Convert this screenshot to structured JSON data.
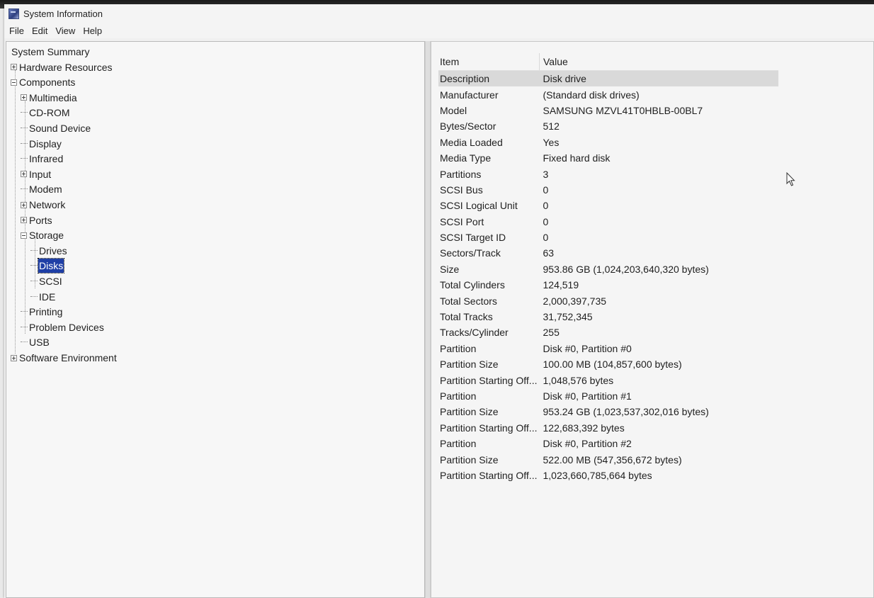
{
  "window": {
    "title": "System Information"
  },
  "menu": [
    "File",
    "Edit",
    "View",
    "Help"
  ],
  "tree": [
    {
      "label": "System Summary",
      "level": 0,
      "expander": "none",
      "line": false
    },
    {
      "label": "Hardware Resources",
      "level": 0,
      "expander": "plus",
      "line": false
    },
    {
      "label": "Components",
      "level": 0,
      "expander": "minus",
      "line": false
    },
    {
      "label": "Multimedia",
      "level": 1,
      "expander": "plus",
      "line": false
    },
    {
      "label": "CD-ROM",
      "level": 1,
      "expander": "none",
      "line": true
    },
    {
      "label": "Sound Device",
      "level": 1,
      "expander": "none",
      "line": true
    },
    {
      "label": "Display",
      "level": 1,
      "expander": "none",
      "line": true
    },
    {
      "label": "Infrared",
      "level": 1,
      "expander": "none",
      "line": true
    },
    {
      "label": "Input",
      "level": 1,
      "expander": "plus",
      "line": false
    },
    {
      "label": "Modem",
      "level": 1,
      "expander": "none",
      "line": true
    },
    {
      "label": "Network",
      "level": 1,
      "expander": "plus",
      "line": false
    },
    {
      "label": "Ports",
      "level": 1,
      "expander": "plus",
      "line": false
    },
    {
      "label": "Storage",
      "level": 1,
      "expander": "minus",
      "line": false
    },
    {
      "label": "Drives",
      "level": 2,
      "expander": "none",
      "line": true
    },
    {
      "label": "Disks",
      "level": 2,
      "expander": "none",
      "line": true,
      "selected": true
    },
    {
      "label": "SCSI",
      "level": 2,
      "expander": "none",
      "line": true
    },
    {
      "label": "IDE",
      "level": 2,
      "expander": "none",
      "line": true
    },
    {
      "label": "Printing",
      "level": 1,
      "expander": "none",
      "line": true
    },
    {
      "label": "Problem Devices",
      "level": 1,
      "expander": "none",
      "line": true
    },
    {
      "label": "USB",
      "level": 1,
      "expander": "none",
      "line": true
    },
    {
      "label": "Software Environment",
      "level": 0,
      "expander": "plus",
      "line": false
    }
  ],
  "details": {
    "headers": {
      "item": "Item",
      "value": "Value"
    },
    "rows": [
      {
        "item": "Description",
        "value": "Disk drive",
        "selected": true
      },
      {
        "item": "Manufacturer",
        "value": "(Standard disk drives)"
      },
      {
        "item": "Model",
        "value": "SAMSUNG MZVL41T0HBLB-00BL7"
      },
      {
        "item": "Bytes/Sector",
        "value": "512"
      },
      {
        "item": "Media Loaded",
        "value": "Yes"
      },
      {
        "item": "Media Type",
        "value": "Fixed hard disk"
      },
      {
        "item": "Partitions",
        "value": "3"
      },
      {
        "item": "SCSI Bus",
        "value": "0"
      },
      {
        "item": "SCSI Logical Unit",
        "value": "0"
      },
      {
        "item": "SCSI Port",
        "value": "0"
      },
      {
        "item": "SCSI Target ID",
        "value": "0"
      },
      {
        "item": "Sectors/Track",
        "value": "63"
      },
      {
        "item": "Size",
        "value": "953.86 GB (1,024,203,640,320 bytes)"
      },
      {
        "item": "Total Cylinders",
        "value": "124,519"
      },
      {
        "item": "Total Sectors",
        "value": "2,000,397,735"
      },
      {
        "item": "Total Tracks",
        "value": "31,752,345"
      },
      {
        "item": "Tracks/Cylinder",
        "value": "255"
      },
      {
        "item": "Partition",
        "value": "Disk #0, Partition #0"
      },
      {
        "item": "Partition Size",
        "value": "100.00 MB (104,857,600 bytes)"
      },
      {
        "item": "Partition Starting Off...",
        "value": "1,048,576 bytes"
      },
      {
        "item": "Partition",
        "value": "Disk #0, Partition #1"
      },
      {
        "item": "Partition Size",
        "value": "953.24 GB (1,023,537,302,016 bytes)"
      },
      {
        "item": "Partition Starting Off...",
        "value": "122,683,392 bytes"
      },
      {
        "item": "Partition",
        "value": "Disk #0, Partition #2"
      },
      {
        "item": "Partition Size",
        "value": "522.00 MB (547,356,672 bytes)"
      },
      {
        "item": "Partition Starting Off...",
        "value": "1,023,660,785,664 bytes"
      }
    ]
  },
  "icons": {
    "app": "system-information-icon",
    "pointer": "mouse-pointer-icon"
  }
}
